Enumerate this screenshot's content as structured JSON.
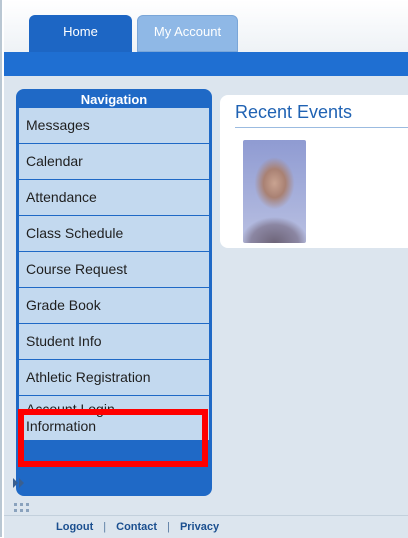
{
  "tabs": [
    {
      "label": "Home"
    },
    {
      "label": "My Account"
    }
  ],
  "navigation": {
    "title": "Navigation",
    "items": [
      {
        "label": "Messages"
      },
      {
        "label": "Calendar"
      },
      {
        "label": "Attendance"
      },
      {
        "label": "Class Schedule"
      },
      {
        "label": "Course Request"
      },
      {
        "label": "Grade Book"
      },
      {
        "label": "Student Info"
      },
      {
        "label": "Athletic Registration"
      },
      {
        "label": "Account Login Information"
      }
    ]
  },
  "recent_events": {
    "title": "Recent Events"
  },
  "footer": {
    "logout": "Logout",
    "contact": "Contact",
    "privacy": "Privacy",
    "separator": "|"
  },
  "colors": {
    "highlight": "#ff0000",
    "nav_background": "#1f69c6",
    "nav_item": "#c3d9ef",
    "header_bar": "#1f6fd2"
  }
}
